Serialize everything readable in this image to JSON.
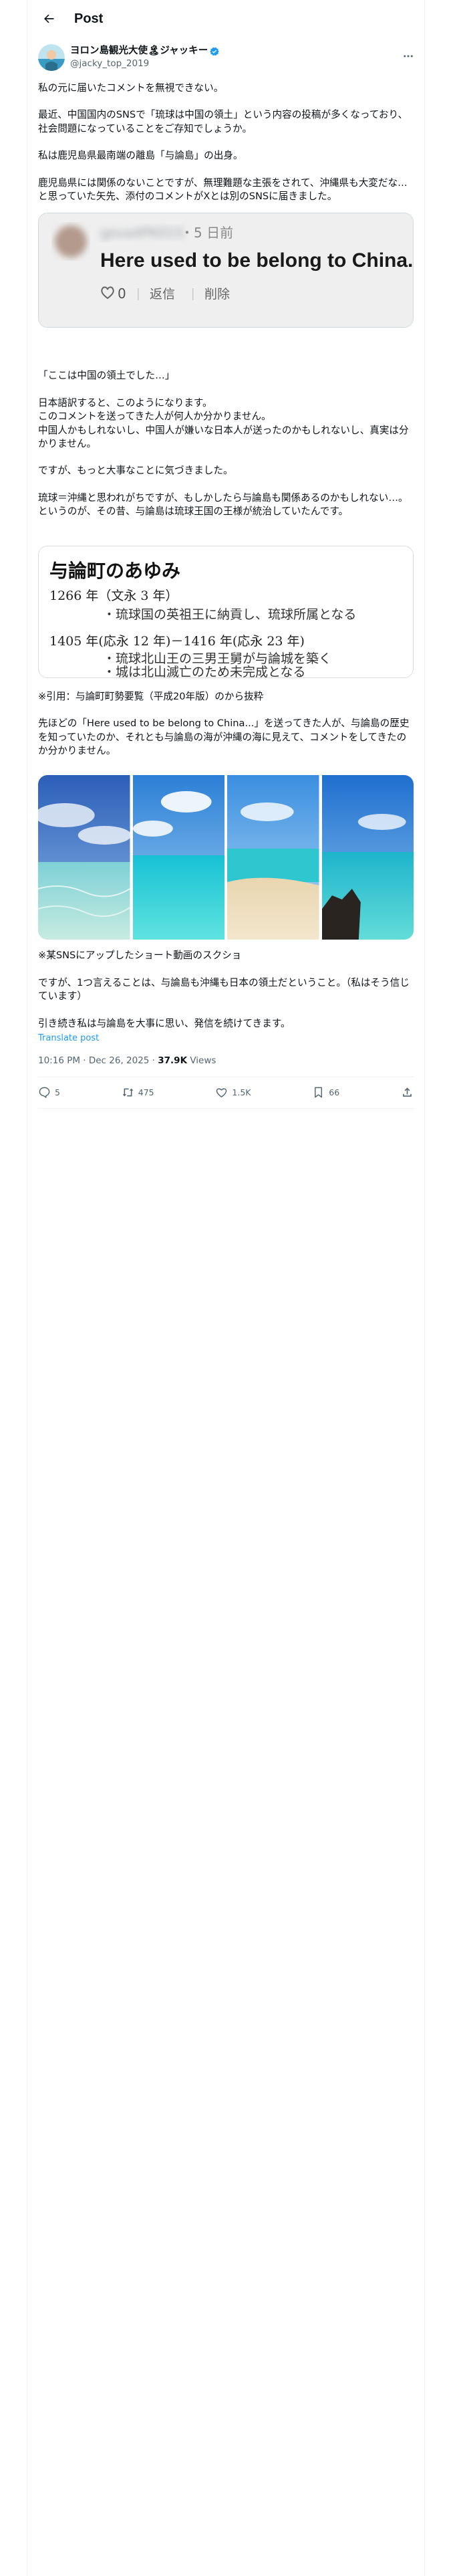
{
  "header": {
    "title": "Post"
  },
  "author": {
    "display_name": "ヨロン島観光大使🏝ジャッキー",
    "handle": "@jacky_top_2019"
  },
  "post": {
    "paragraphs": [
      "私の元に届いたコメントを無視できない。",
      "最近、中国国内のSNSで「琉球は中国の領土」という内容の投稿が多くなっており、社会問題になっていることをご存知でしょうか。",
      "私は鹿児島県最南端の離島「与論島」の出身。",
      "鹿児島県には関係のないことですが、無理難題な主張をされて、沖縄県も大変だな…と思っていた矢先、添付のコメントがXとは別のSNSに届きました。"
    ],
    "paragraphs2": [
      "「ここは中国の領土でした…」",
      "日本語訳すると、このようになります。\nこのコメントを送ってきた人が何人か分かりません。\n中国人かもしれないし、中国人が嫌いな日本人が送ったのかもしれないし、真実は分かりません。",
      "ですが、もっと大事なことに気づきました。",
      "琉球＝沖縄と思われがちですが、もしかしたら与論島も関係あるのかもしれない…。\nというのが、その昔、与論島は琉球王国の王様が統治していたんです。"
    ],
    "paragraphs3": [
      "※引用：与論町町勢要覧（平成20年版）のから抜粋",
      "先ほどの「Here used to be belong to China...」を送ってきた人が、与論島の歴史を知っていたのか、それとも与論島の海が沖縄の海に見えて、コメントをしてきたのか分かりません。"
    ],
    "paragraphs4": [
      "※某SNSにアップしたショート動画のスクショ",
      "ですが、1つ言えることは、与論島も沖縄も日本の領土だということ。（私はそう信じています）",
      "引き続き私は与論島を大事に思い、発信を続けてきます。"
    ],
    "translate_label": "Translate post"
  },
  "comment_card": {
    "username": "gova4PK01S",
    "time": "・5 日前",
    "text": "Here used to be belong to China...",
    "likes": "0",
    "reply_label": "返信",
    "delete_label": "削除"
  },
  "history_card": {
    "title": "与論町のあゆみ",
    "entries": [
      {
        "year": "1266 年（文永 3 年）",
        "items": [
          "・琉球国の英祖王に納貢し、琉球所属となる"
        ]
      },
      {
        "year": "1405 年(応永 12 年)－1416 年(応永 23 年)",
        "items": [
          "・琉球北山王の三男王舅が与論城を築く",
          "・城は北山滅亡のため未完成となる"
        ]
      }
    ]
  },
  "meta": {
    "timestamp": "10:16 PM · Dec 26, 2025",
    "separator": " · ",
    "views_count": "37.9K",
    "views_label": " Views"
  },
  "actions": {
    "replies": "5",
    "reposts": "475",
    "likes": "1.5K",
    "bookmarks": "66"
  },
  "colors": {
    "accent": "#1d9bf0",
    "text": "#0f1419",
    "muted": "#536471",
    "border": "#eff3f4"
  }
}
